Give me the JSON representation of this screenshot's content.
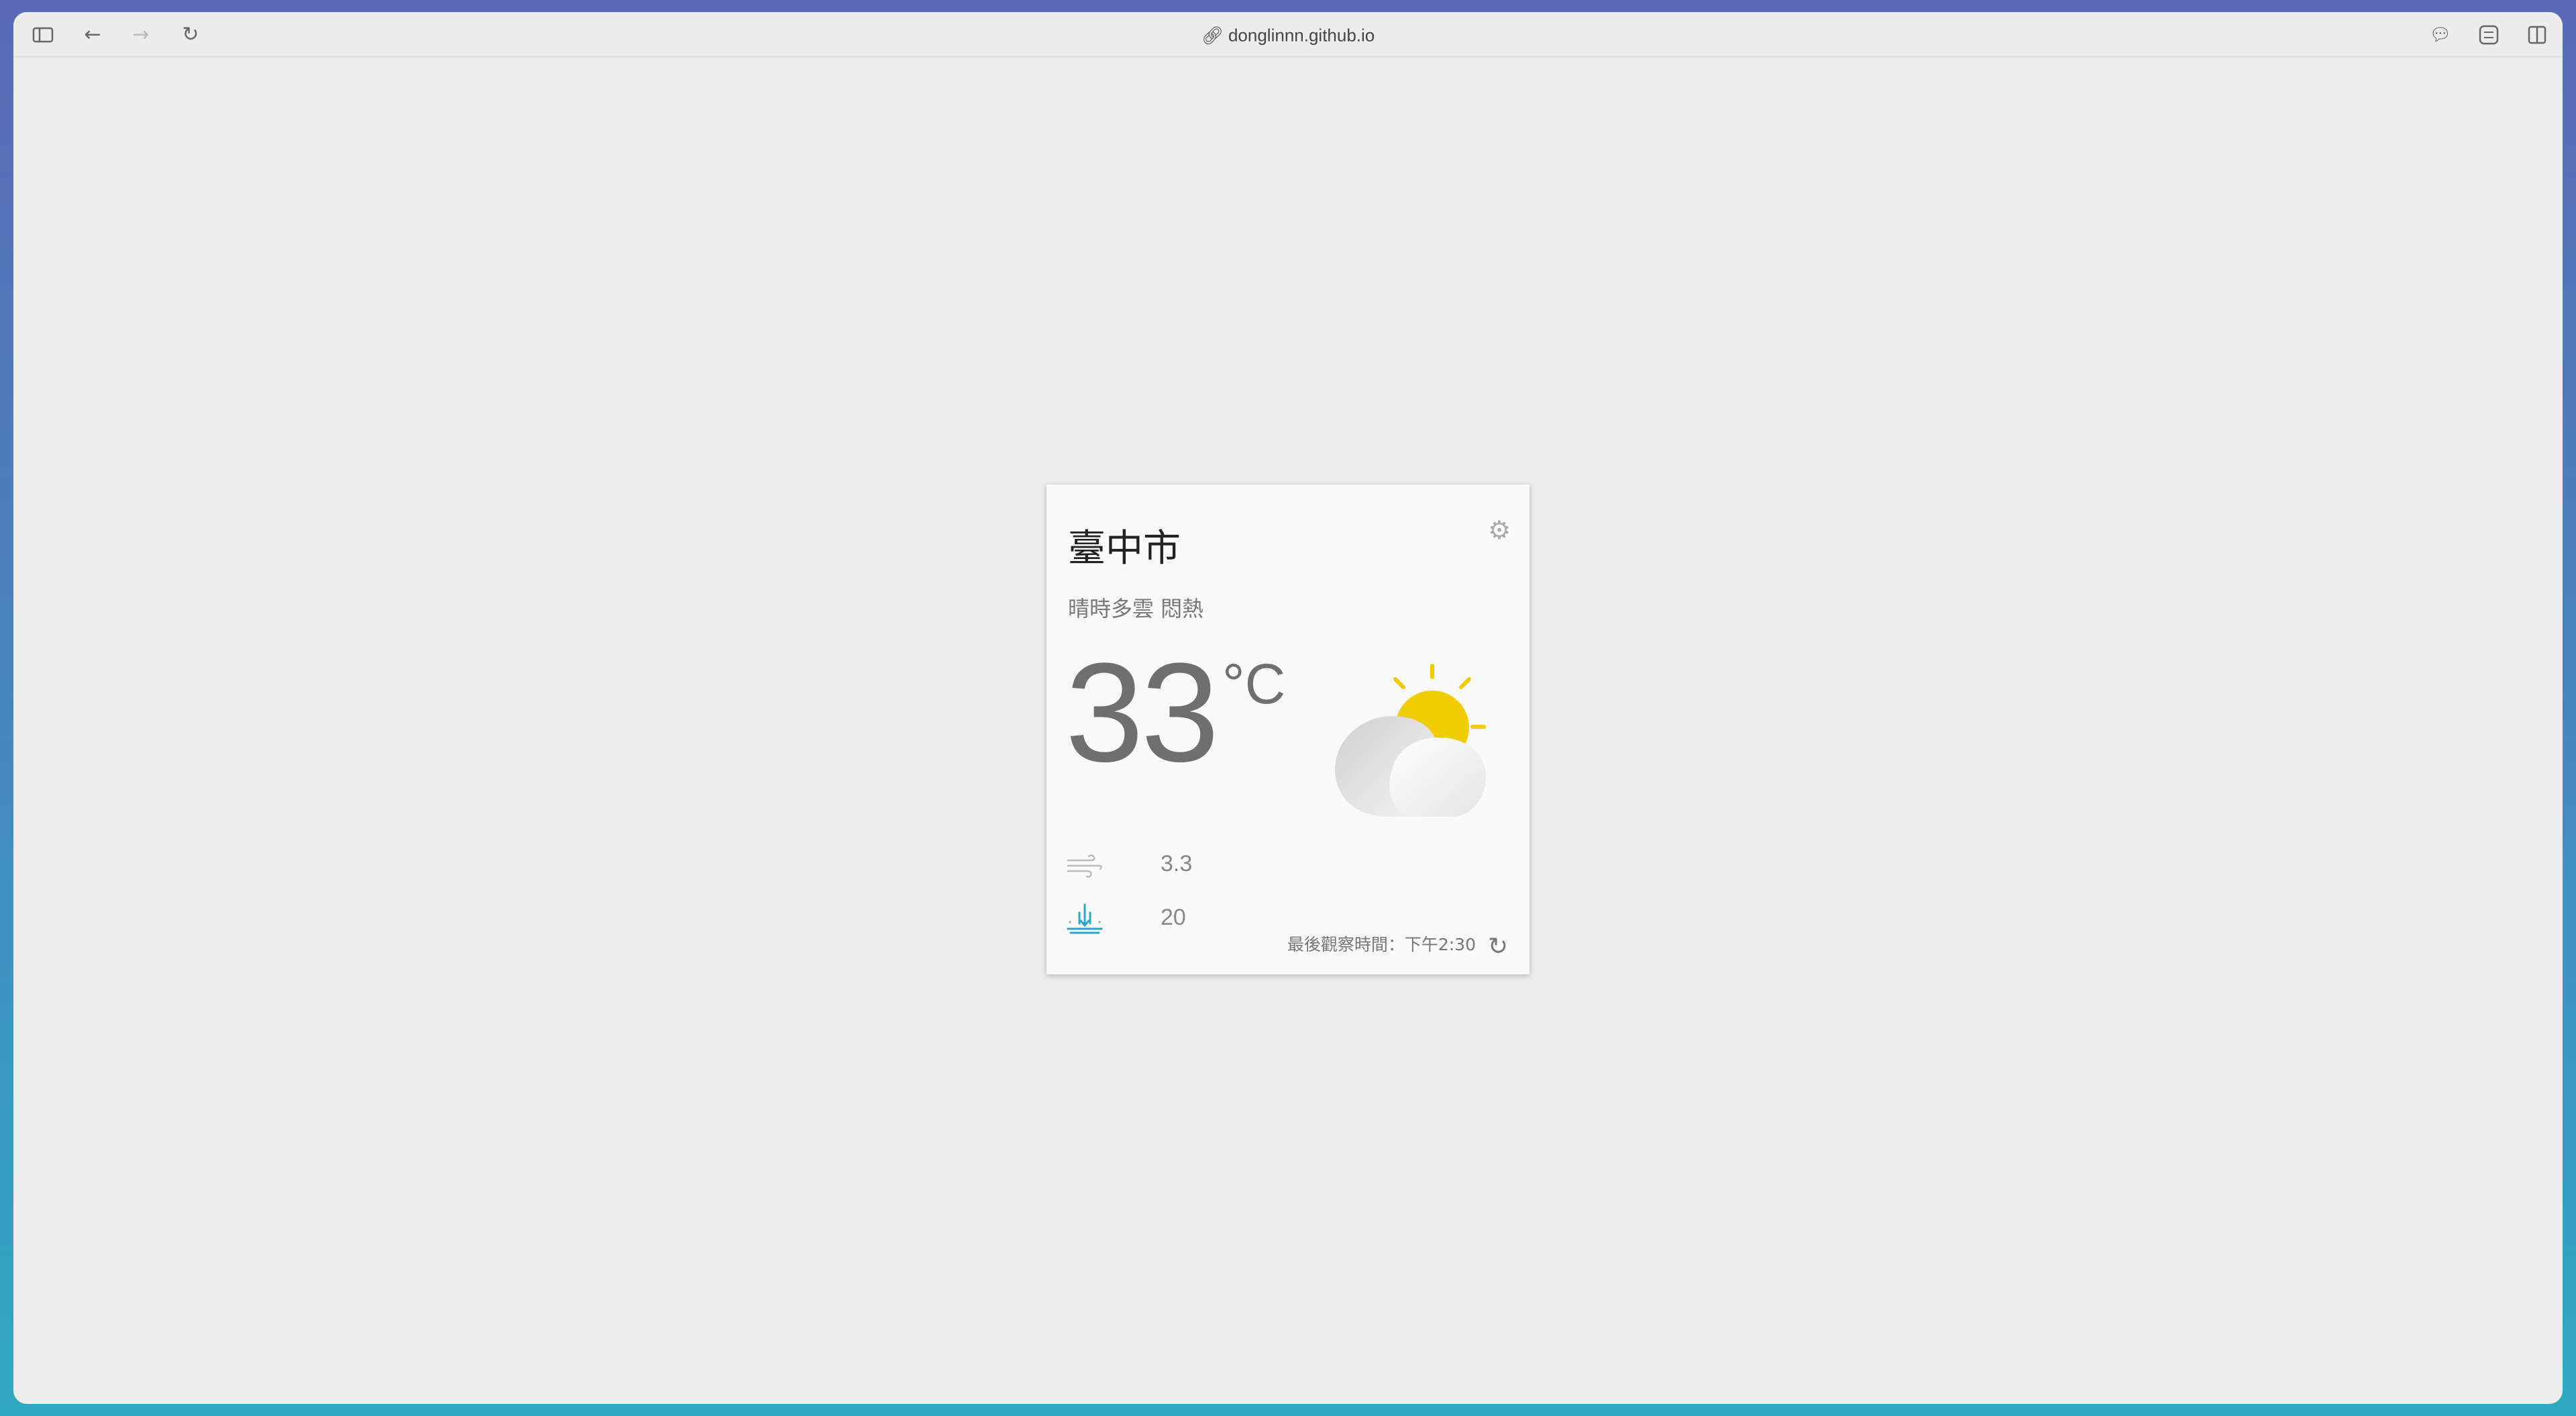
{
  "browser": {
    "url": "donglinnn.github.io",
    "icons": [
      "sidebar-icon",
      "back-icon",
      "forward-icon",
      "reload-icon",
      "link-icon",
      "speech-bubble-icon",
      "sliders-icon",
      "split-view-icon"
    ]
  },
  "weather": {
    "city": "臺中市",
    "description": "晴時多雲 悶熱",
    "temperature": "33",
    "unit": "°C",
    "wind_speed": "3.3",
    "rain_probability": "20",
    "observation_time": "最後觀察時間：下午2:30",
    "condition_icon": "partly-cloudy-day",
    "colors": {
      "sun": "#f0cc00",
      "rain_icon": "#29a6c9"
    }
  }
}
